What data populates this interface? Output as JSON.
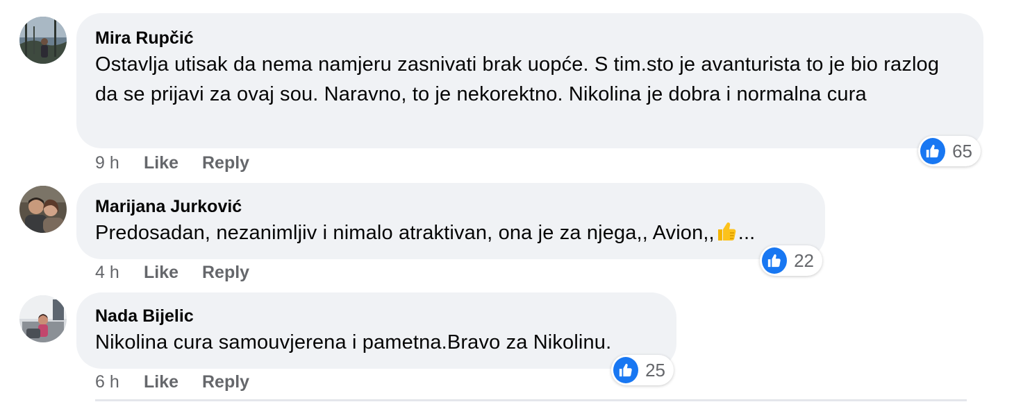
{
  "comments": [
    {
      "author": "Mira Rupčić",
      "text": "Ostavlja utisak da nema namjeru zasnivati brak uopće. S tim.sto je avanturista to je bio razlog da se prijavi za ovaj sou. Naravno, to je nekorektno. Nikolina je dobra i normalna cura",
      "time": "9 h",
      "like_label": "Like",
      "reply_label": "Reply",
      "reaction_count": "65",
      "reaction_icon": "like-icon"
    },
    {
      "author": "Marijana Jurković",
      "text": "Predosadan, nezanimljiv i nimalo atraktivan, ona je za njega,, Avion,,",
      "text_suffix": "...",
      "inline_emoji": "thumbs-up-icon",
      "time": "4 h",
      "like_label": "Like",
      "reply_label": "Reply",
      "reaction_count": "22",
      "reaction_icon": "like-icon"
    },
    {
      "author": "Nada Bijelic",
      "text": "Nikolina cura samouvjerena i pametna.Bravo za Nikolinu.",
      "time": "6 h",
      "like_label": "Like",
      "reply_label": "Reply",
      "reaction_count": "25",
      "reaction_icon": "like-icon"
    }
  ],
  "colors": {
    "bubble": "#f0f2f5",
    "like_blue": "#1877f2",
    "meta_gray": "#65676b",
    "text": "#050505"
  }
}
